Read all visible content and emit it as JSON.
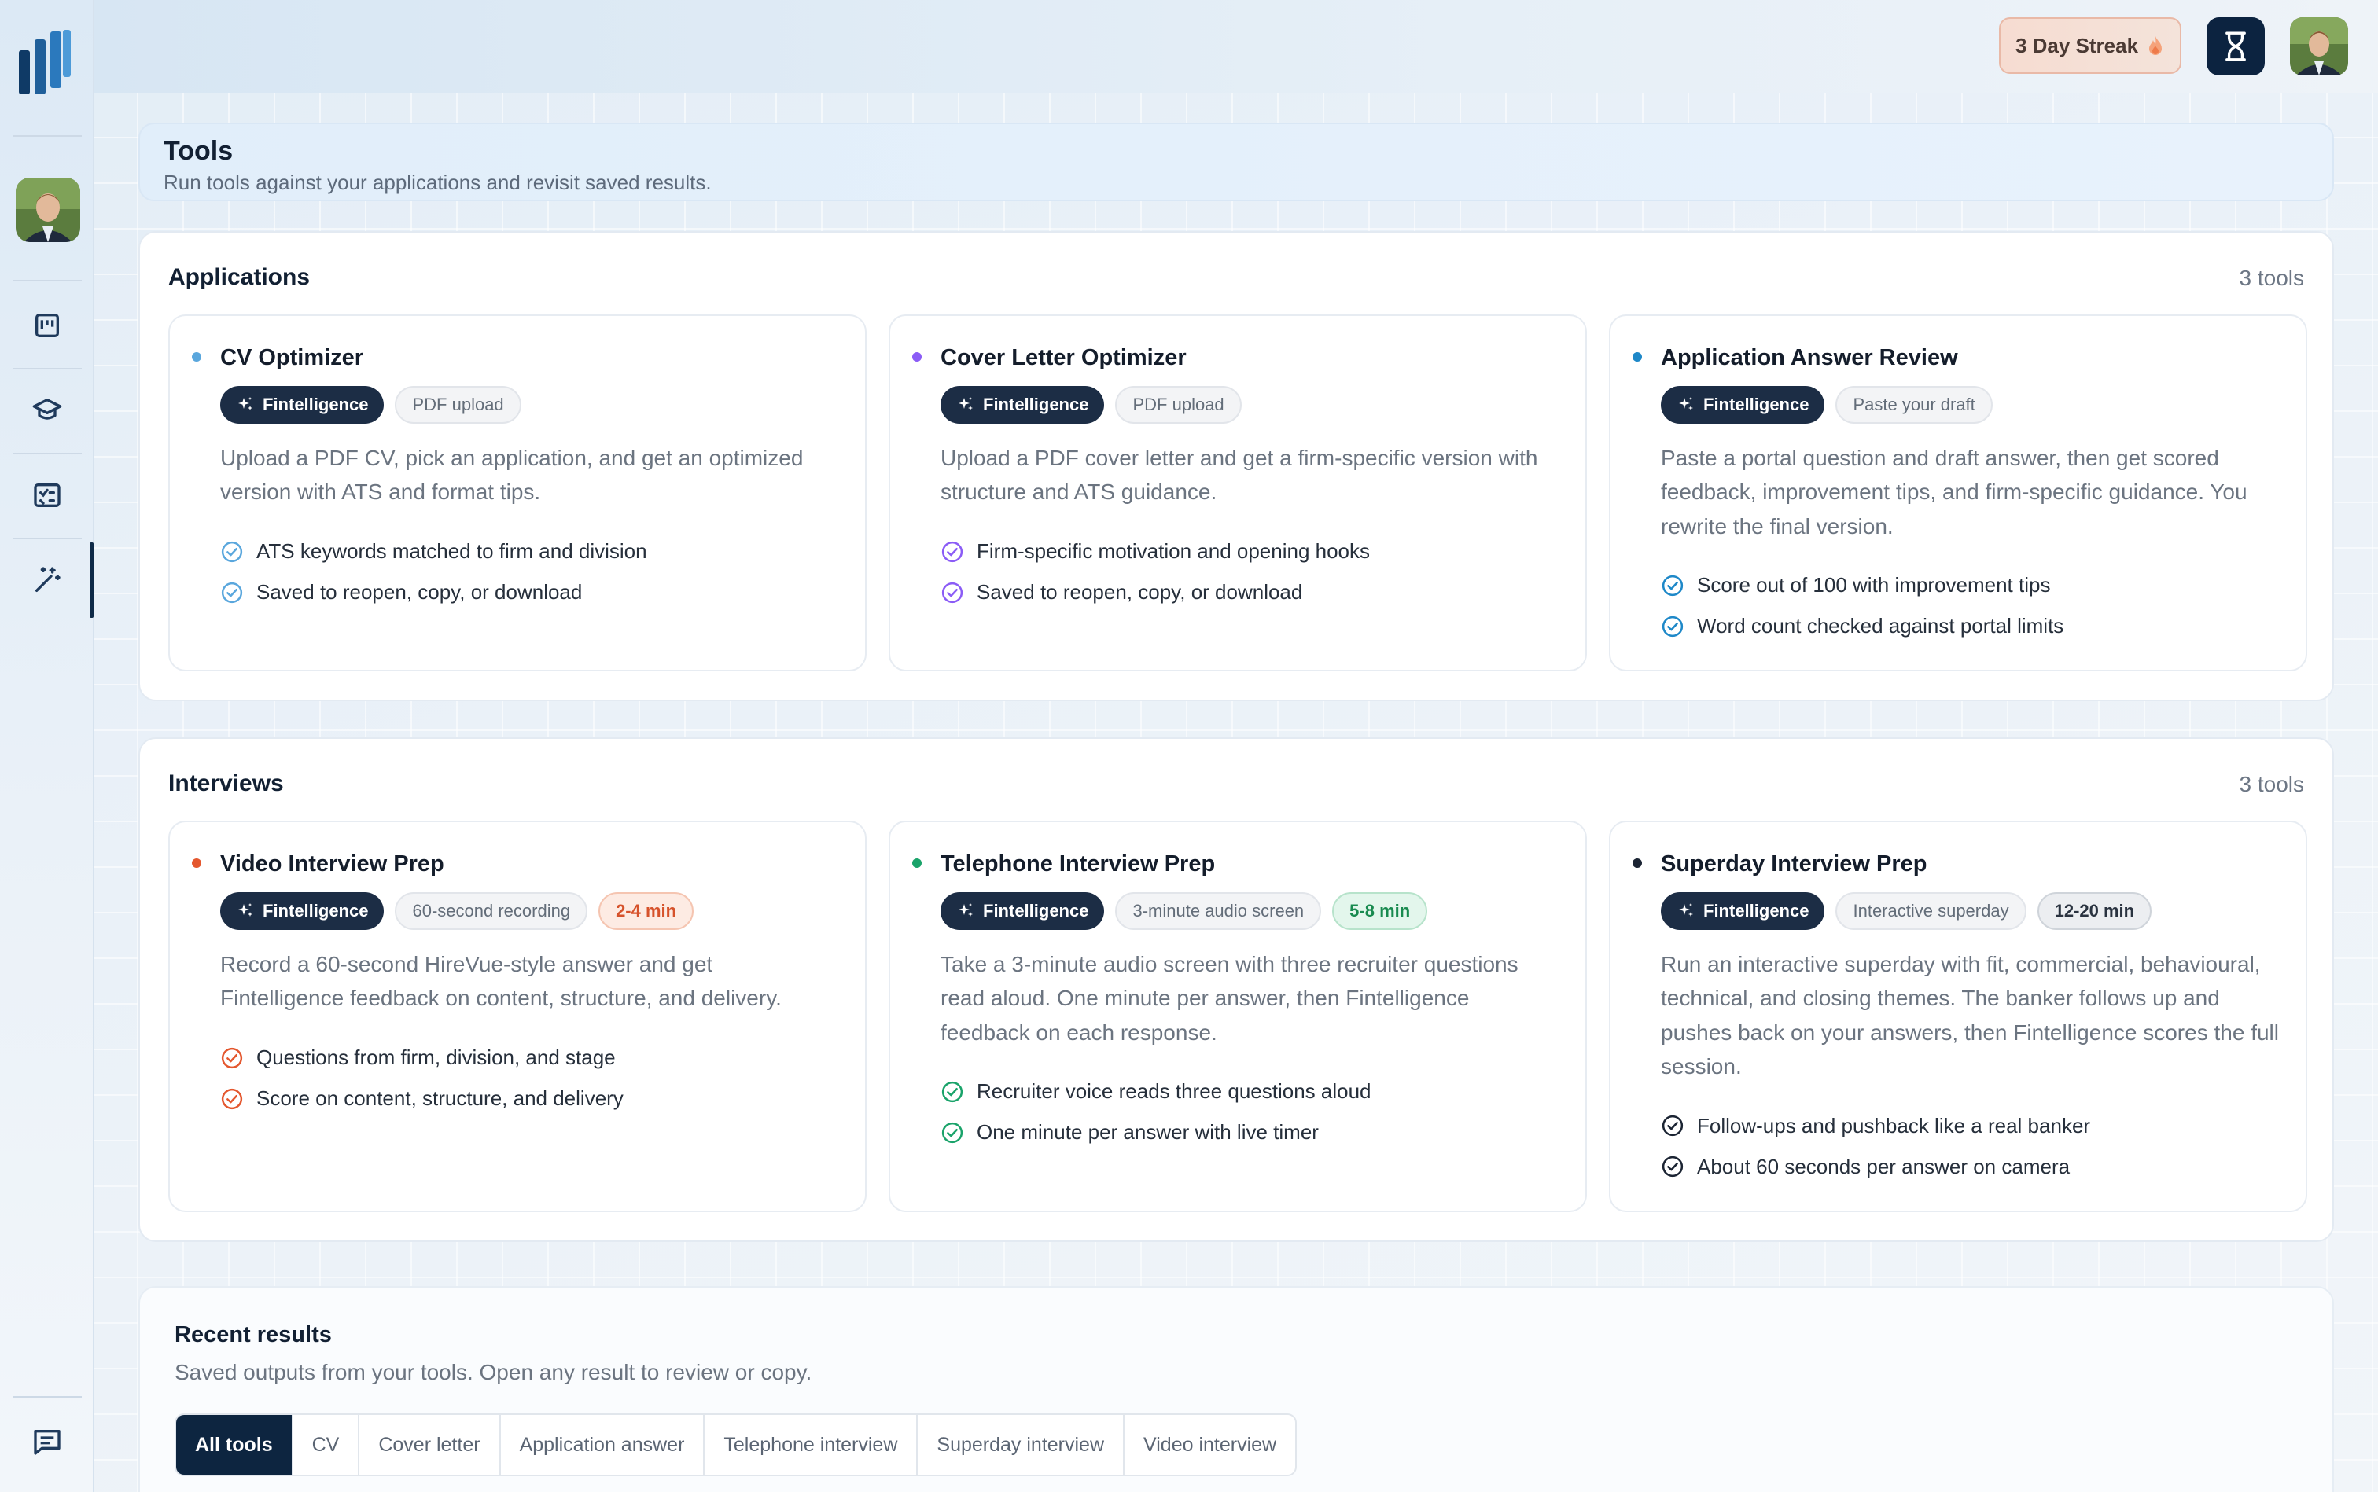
{
  "header": {
    "streak_label": "3 Day Streak"
  },
  "tools_header": {
    "title": "Tools",
    "subtitle": "Run tools against your applications and revisit saved results."
  },
  "sections": [
    {
      "title": "Applications",
      "count": "3 tools",
      "cards": [
        {
          "title": "CV Optimizer",
          "dot_color": "#5aa7dd",
          "check_color": "#5aa7dd",
          "chips": [
            "Fintelligence",
            "PDF upload"
          ],
          "desc": "Upload a PDF CV, pick an application, and get an optimized version with ATS and format tips.",
          "features": [
            "ATS keywords matched to firm and division",
            "Saved to reopen, copy, or download"
          ]
        },
        {
          "title": "Cover Letter Optimizer",
          "dot_color": "#8b5cf6",
          "check_color": "#8b5cf6",
          "chips": [
            "Fintelligence",
            "PDF upload"
          ],
          "desc": "Upload a PDF cover letter and get a firm-specific version with structure and ATS guidance.",
          "features": [
            "Firm-specific motivation and opening hooks",
            "Saved to reopen, copy, or download"
          ]
        },
        {
          "title": "Application Answer Review",
          "dot_color": "#1e88c8",
          "check_color": "#1e88c8",
          "chips": [
            "Fintelligence",
            "Paste your draft"
          ],
          "desc": "Paste a portal question and draft answer, then get scored feedback, improvement tips, and firm-specific guidance. You rewrite the final version.",
          "features": [
            "Score out of 100 with improvement tips",
            "Word count checked against portal limits"
          ]
        }
      ]
    },
    {
      "title": "Interviews",
      "count": "3 tools",
      "cards": [
        {
          "title": "Video Interview Prep",
          "dot_color": "#e4572e",
          "check_color": "#e4572e",
          "chips": [
            "Fintelligence",
            "60-second recording"
          ],
          "duration": "2-4 min",
          "duration_style": "orange",
          "desc": "Record a 60-second HireVue-style answer and get Fintelligence feedback on content, structure, and delivery.",
          "features": [
            "Questions from firm, division, and stage",
            "Score on content, structure, and delivery"
          ]
        },
        {
          "title": "Telephone Interview Prep",
          "dot_color": "#1aa36a",
          "check_color": "#1aa36a",
          "chips": [
            "Fintelligence",
            "3-minute audio screen"
          ],
          "duration": "5-8 min",
          "duration_style": "green",
          "desc": "Take a 3-minute audio screen with three recruiter questions read aloud. One minute per answer, then Fintelligence feedback on each response.",
          "features": [
            "Recruiter voice reads three questions aloud",
            "One minute per answer with live timer"
          ]
        },
        {
          "title": "Superday Interview Prep",
          "dot_color": "#1b2433",
          "check_color": "#1b2433",
          "chips": [
            "Fintelligence",
            "Interactive superday"
          ],
          "duration": "12-20 min",
          "duration_style": "gray",
          "desc": "Run an interactive superday with fit, commercial, behavioural, technical, and closing themes. The banker follows up and pushes back on your answers, then Fintelligence scores the full session.",
          "features": [
            "Follow-ups and pushback like a real banker",
            "About 60 seconds per answer on camera"
          ]
        }
      ]
    }
  ],
  "recent": {
    "title": "Recent results",
    "subtitle": "Saved outputs from your tools. Open any result to review or copy.",
    "tabs": [
      "All tools",
      "CV",
      "Cover letter",
      "Application answer",
      "Telephone interview",
      "Superday interview",
      "Video interview"
    ],
    "active_tab": 0
  },
  "icons": {
    "sidebar": [
      "logo-icon",
      "board-icon",
      "graduation-cap-icon",
      "checklist-icon",
      "magic-wand-icon",
      "chat-icon"
    ],
    "header": [
      "flame-icon",
      "hourglass-icon"
    ]
  }
}
